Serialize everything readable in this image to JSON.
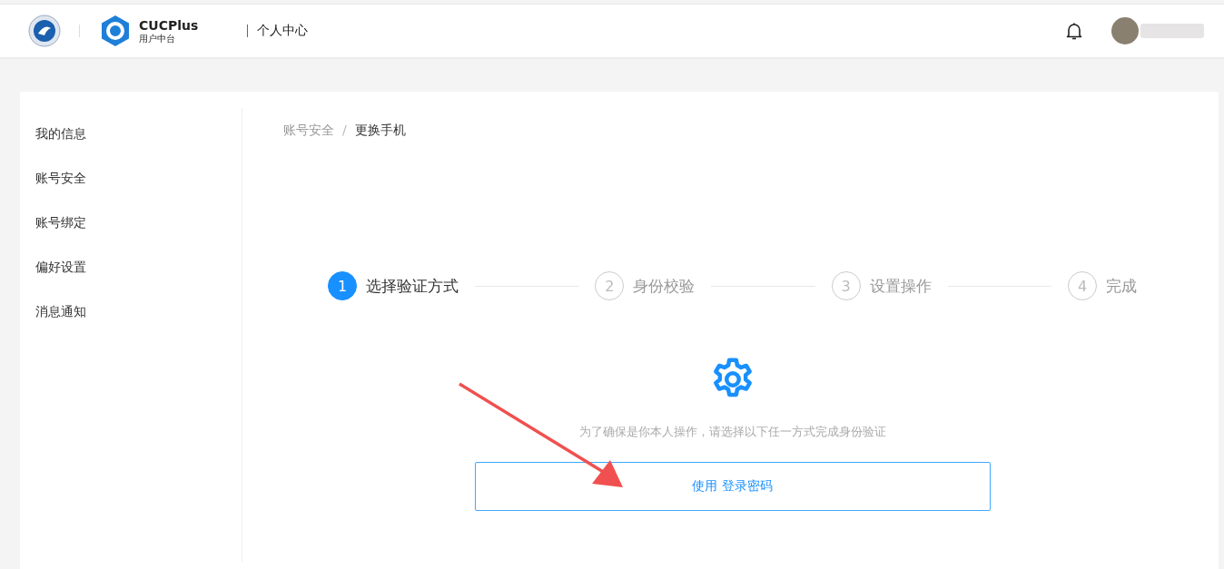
{
  "header": {
    "brand": "CUCPlus",
    "brand_sub": "用户中台",
    "section": "个人中心"
  },
  "sidebar": {
    "items": [
      {
        "label": "我的信息",
        "selected": false
      },
      {
        "label": "账号安全",
        "selected": false
      },
      {
        "label": "账号绑定",
        "selected": false
      },
      {
        "label": "偏好设置",
        "selected": false
      },
      {
        "label": "消息通知",
        "selected": false
      }
    ]
  },
  "breadcrumb": [
    {
      "label": "账号安全",
      "current": false
    },
    {
      "label": "更换手机",
      "current": true
    }
  ],
  "breadcrumb_separator": "/",
  "steps": [
    {
      "number": "1",
      "label": "选择验证方式",
      "active": true
    },
    {
      "number": "2",
      "label": "身份校验",
      "active": false
    },
    {
      "number": "3",
      "label": "设置操作",
      "active": false
    },
    {
      "number": "4",
      "label": "完成",
      "active": false
    }
  ],
  "verify": {
    "hint": "为了确保是你本人操作，请选择以下任一方式完成身份验证",
    "button": "使用 登录密码"
  }
}
